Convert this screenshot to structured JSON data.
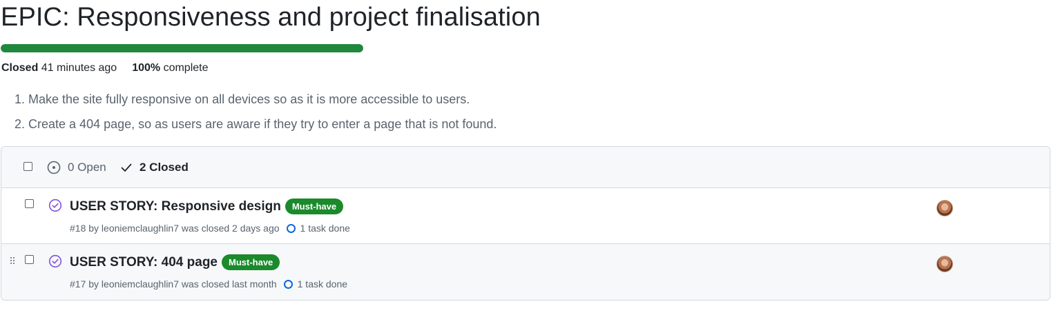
{
  "milestone": {
    "title": "EPIC: Responsiveness and project finalisation",
    "progress_percent": 100,
    "status_label": "Closed",
    "status_time": "41 minutes ago",
    "percent_label": "100%",
    "percent_suffix": "complete",
    "description": [
      "1. Make the site fully responsive on all devices so as it is more accessible to users.",
      "2. Create a 404 page, so as users are aware if they try to enter a page that is not found."
    ]
  },
  "filters": {
    "open_label": "0 Open",
    "closed_label": "2 Closed"
  },
  "issues": [
    {
      "title": "USER STORY: Responsive design",
      "label": "Must-have",
      "meta": "#18 by leoniemclaughlin7 was closed 2 days ago",
      "task": "1 task done"
    },
    {
      "title": "USER STORY: 404 page",
      "label": "Must-have",
      "meta": "#17 by leoniemclaughlin7 was closed last month",
      "task": "1 task done"
    }
  ],
  "colors": {
    "progress": "#1f883d",
    "label_bg": "#1a8a2b",
    "closed_icon": "#8250df",
    "task_ring": "#0969da"
  }
}
